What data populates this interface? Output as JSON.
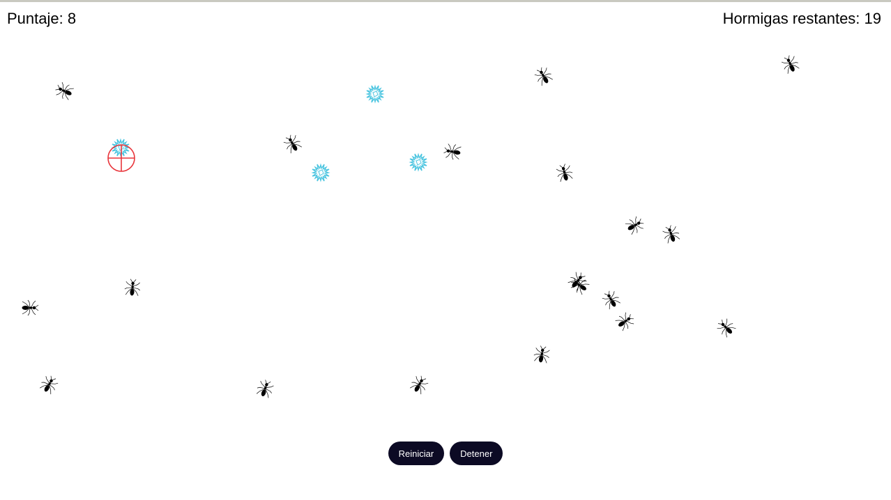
{
  "hud": {
    "score_text": "Puntaje: 8",
    "remaining_text": "Hormigas restantes: 19"
  },
  "controls": {
    "restart_label": "Reiniciar",
    "stop_label": "Detener"
  },
  "colors": {
    "ant": "#000000",
    "splat": "#4cc5e0",
    "crosshair": "#e8343a",
    "button_bg": "#0c0a24",
    "button_text": "#ffffff"
  },
  "icons": {
    "ant": "ant-icon",
    "splat": "splat-icon",
    "crosshair": "crosshair-icon"
  }
}
